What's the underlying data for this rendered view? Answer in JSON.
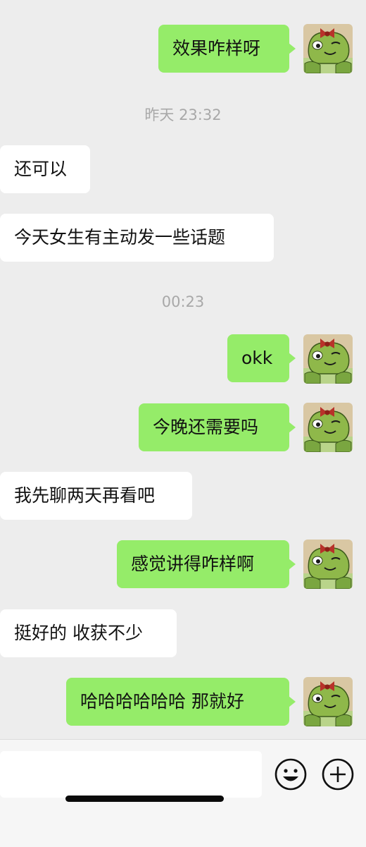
{
  "chat": {
    "messages": [
      {
        "from": "me",
        "text": "效果咋样呀"
      },
      {
        "type": "time",
        "text": "昨天 23:32"
      },
      {
        "from": "them",
        "text": "还可以"
      },
      {
        "from": "them",
        "text": "今天女生有主动发一些话题"
      },
      {
        "type": "time",
        "text": "00:23"
      },
      {
        "from": "me",
        "text": "okk"
      },
      {
        "from": "me",
        "text": "今晚还需要吗"
      },
      {
        "from": "them",
        "text": "我先聊两天再看吧"
      },
      {
        "from": "me",
        "text": "感觉讲得咋样啊"
      },
      {
        "from": "them",
        "text": "挺好的 收获不少"
      },
      {
        "from": "me",
        "text": "哈哈哈哈哈哈 那就好"
      }
    ]
  },
  "avatar": {
    "name": "frog-avatar-icon",
    "colors": {
      "frog": "#8fb84a",
      "bow": "#b8322a",
      "background": "#d9c7a3"
    }
  },
  "input_bar": {
    "value": "",
    "emoji_icon": "emoji-icon",
    "plus_icon": "plus-icon"
  },
  "colors": {
    "background": "#ededed",
    "bubble_me": "#95ec69",
    "bubble_them": "#ffffff",
    "timestamp": "#a8a8a8"
  }
}
